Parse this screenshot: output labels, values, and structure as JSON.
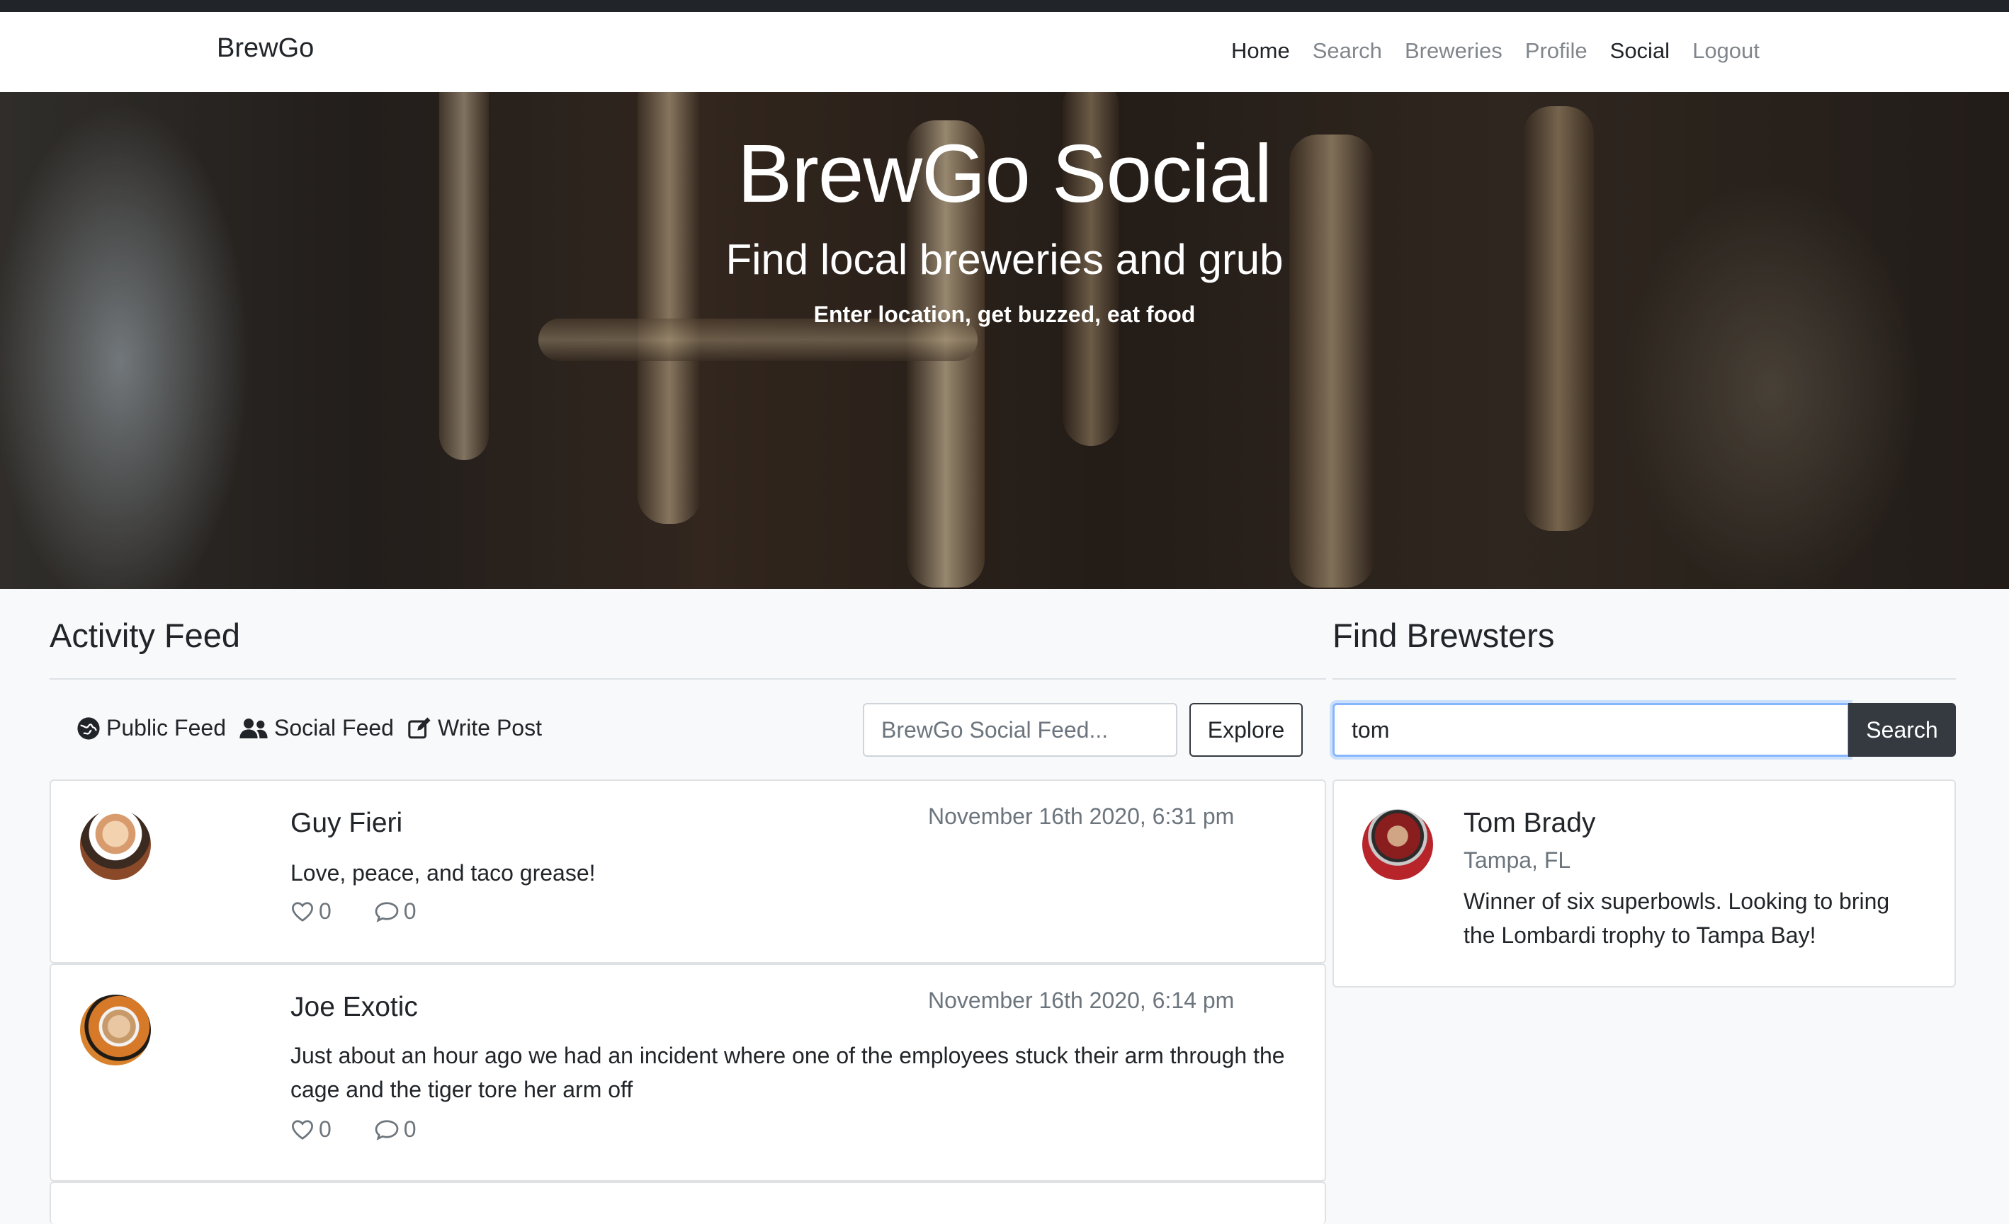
{
  "navbar": {
    "brand": "BrewGo",
    "links": [
      "Home",
      "Search",
      "Breweries",
      "Profile",
      "Social",
      "Logout"
    ]
  },
  "hero": {
    "title": "BrewGo Social",
    "subtitle": "Find local breweries and grub",
    "tagline": "Enter location, get buzzed, eat food"
  },
  "activity": {
    "title": "Activity Feed",
    "tabs": [
      "Public Feed",
      "Social Feed",
      "Write Post"
    ],
    "search_placeholder": "BrewGo Social Feed...",
    "explore_label": "Explore",
    "posts": [
      {
        "name": "Guy Fieri",
        "date": "November 16th 2020, 6:31 pm",
        "body": "Love, peace, and taco grease!",
        "likes": "0",
        "comments": "0"
      },
      {
        "name": "Joe Exotic",
        "date": "November 16th 2020, 6:14 pm",
        "body": "Just about an hour ago we had an incident where one of the employees stuck their arm through the cage and the tiger tore her arm off",
        "likes": "0",
        "comments": "0"
      }
    ]
  },
  "brewsters": {
    "title": "Find Brewsters",
    "search_value": "tom",
    "search_label": "Search",
    "results": [
      {
        "name": "Tom Brady",
        "location": "Tampa, FL",
        "bio": "Winner of six superbowls. Looking to bring the Lombardi trophy to Tampa Bay!"
      }
    ]
  },
  "colors": {
    "navbar_bg": "#ffffff",
    "page_bg": "#f8f9fa",
    "dark_button": "#343a40",
    "muted_text": "#6c757d",
    "focus_ring": "#86b7fe"
  },
  "icons": [
    "globe-icon",
    "users-icon",
    "edit-icon",
    "heart-icon",
    "comment-icon"
  ]
}
